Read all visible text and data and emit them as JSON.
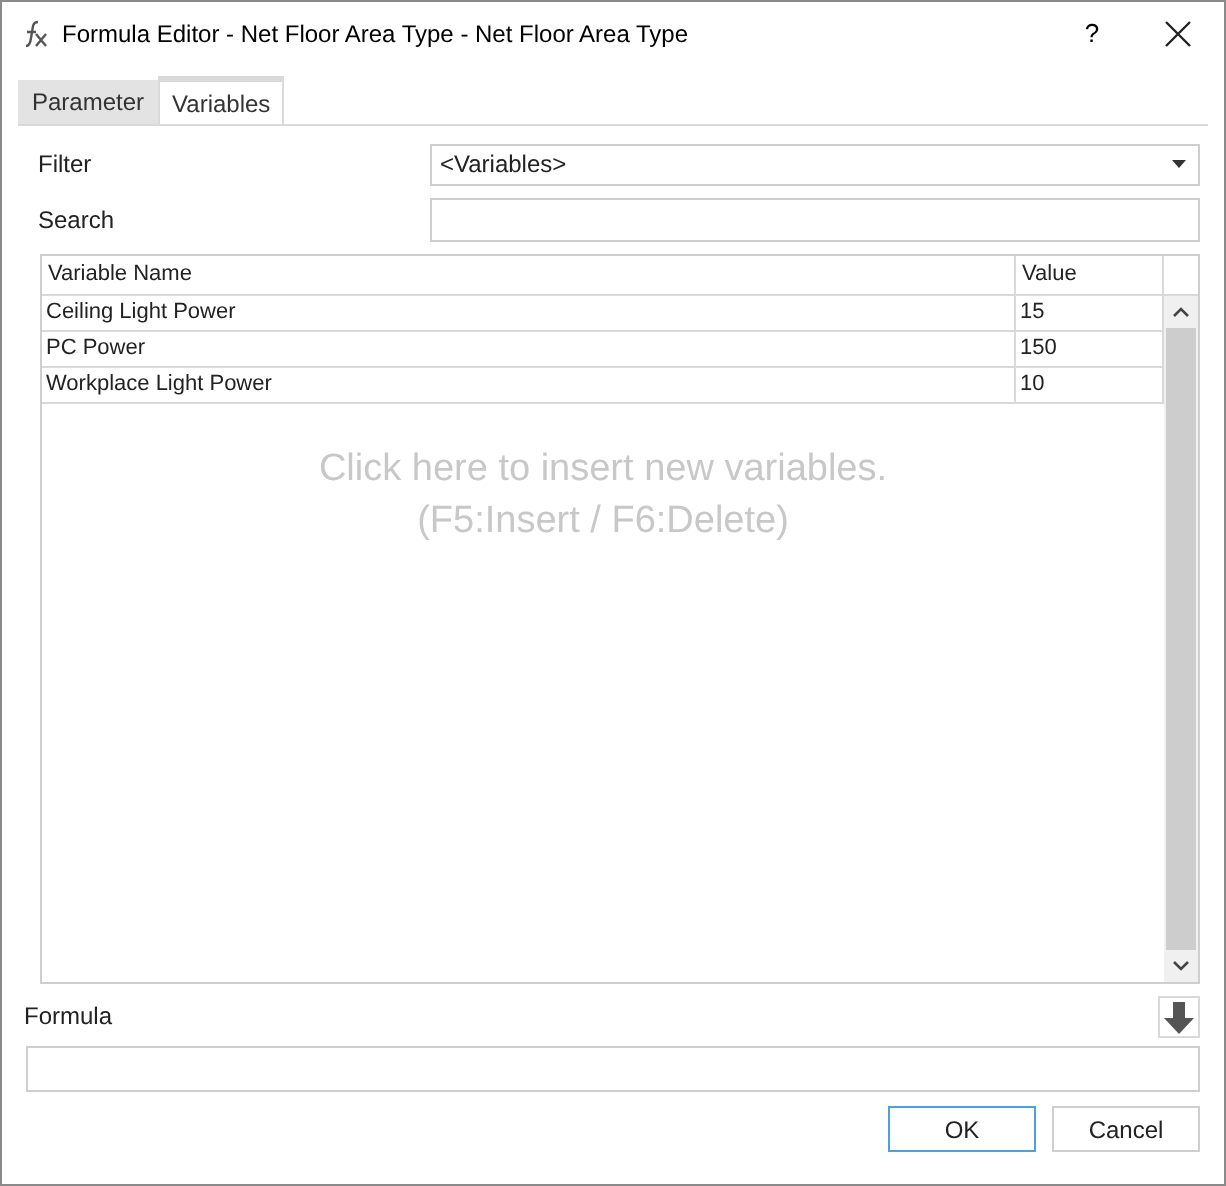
{
  "window": {
    "title": "Formula Editor - Net Floor Area Type - Net Floor Area Type",
    "help": "?"
  },
  "tabs": [
    {
      "label": "Parameter",
      "selected": false
    },
    {
      "label": "Variables",
      "selected": true
    }
  ],
  "filter": {
    "label": "Filter",
    "value": "<Variables>"
  },
  "search": {
    "label": "Search"
  },
  "table": {
    "columns": [
      "Variable Name",
      "Value"
    ],
    "rows": [
      [
        "Ceiling Light Power",
        "15"
      ],
      [
        "PC Power",
        "150"
      ],
      [
        "Workplace Light Power",
        "10"
      ]
    ],
    "hint": [
      "Click here to insert new variables.",
      "(F5:Insert / F6:Delete)"
    ]
  },
  "formula": {
    "label": "Formula"
  },
  "buttons": [
    {
      "label": "OK",
      "default": true
    },
    {
      "label": "Cancel",
      "default": false
    }
  ]
}
